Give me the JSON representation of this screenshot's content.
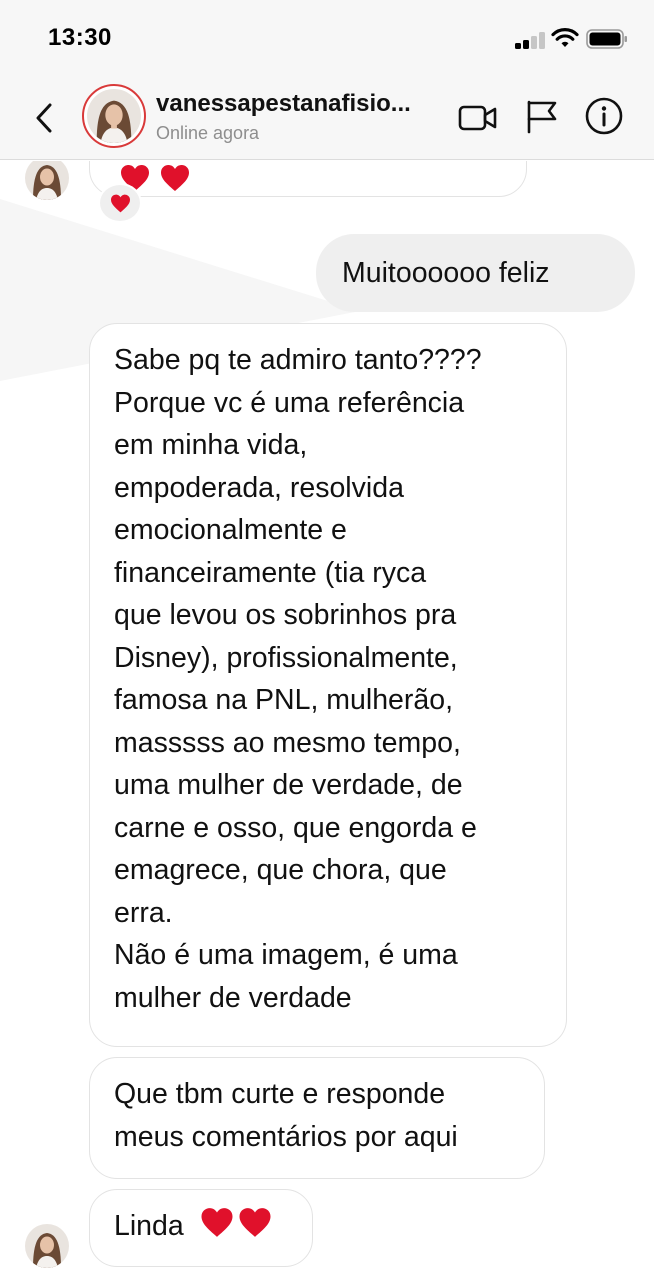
{
  "status_bar": {
    "time": "13:30"
  },
  "header": {
    "username": "vanessapestanafisio...",
    "presence": "Online agora"
  },
  "messages": [
    {
      "direction": "incoming",
      "text": "",
      "emoji": "❤️❤️"
    },
    {
      "direction": "outgoing",
      "text": "Muitoooooo feliz"
    },
    {
      "direction": "incoming",
      "lines": [
        "Sabe pq te admiro tanto????",
        "Porque vc é uma referência",
        "em minha vida,",
        "empoderada, resolvida",
        "emocionalmente e",
        "financeiramente (tia ryca",
        "que levou os sobrinhos pra",
        "Disney), profissionalmente,",
        "famosa na PNL, mulherão,",
        "masssss ao mesmo tempo,",
        "uma mulher de verdade, de",
        "carne e osso, que engorda e",
        "emagrece, que chora,  que",
        "erra.",
        "Não é uma imagem, é uma",
        "mulher de verdade"
      ]
    },
    {
      "direction": "incoming",
      "lines": [
        "Que tbm curte e responde",
        "meus comentários por aqui"
      ]
    },
    {
      "direction": "incoming",
      "text": "Linda",
      "emoji": "❤️❤️"
    }
  ],
  "reaction": {
    "emoji": "❤️"
  },
  "icons": {
    "back": "chevron-left-icon",
    "video": "video-camera-icon",
    "flag": "flag-icon",
    "info": "info-icon",
    "heart": "heart-icon"
  },
  "colors": {
    "heart": "#e0112b",
    "avatar_ring": "#d93a3a",
    "incoming_bubble_border": "#e3e3e3",
    "outgoing_bubble": "#efefef",
    "secondary_text": "#8e8e8e"
  }
}
